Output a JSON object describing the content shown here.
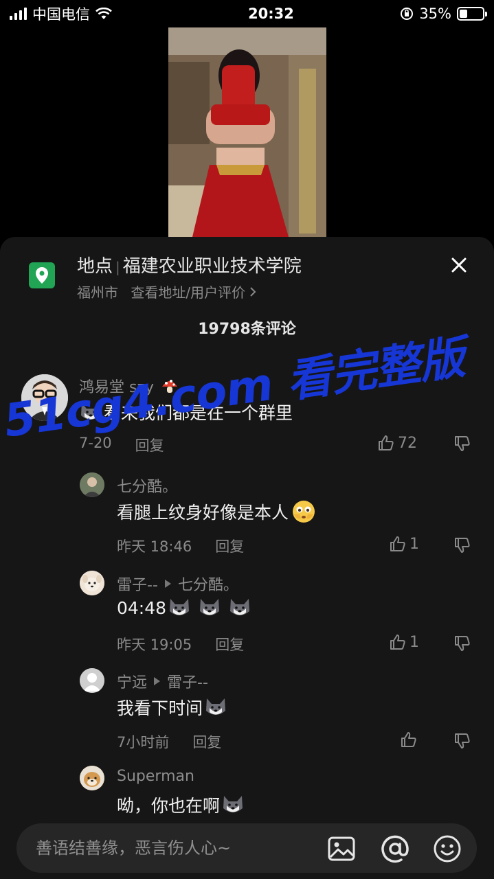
{
  "status_bar": {
    "carrier": "中国电信",
    "time": "20:32",
    "battery": "35%",
    "battery_level": 0.35
  },
  "location": {
    "label": "地点",
    "name": "福建农业职业技术学院",
    "city": "福州市",
    "link": "查看地址/用户评价"
  },
  "comments_count": "19798条评论",
  "comments": [
    {
      "name": "鸿易堂 szy",
      "text": "看来我们都是在一个群里",
      "date": "7-20",
      "reply": "回复",
      "likes": "72"
    },
    {
      "name": "七分酷。",
      "text": "看腿上纹身好像是本人",
      "date": "昨天 18:46",
      "reply": "回复",
      "likes": "1"
    },
    {
      "name": "雷子--",
      "reply_to": "七分酷。",
      "text": "04:48",
      "date": "昨天 19:05",
      "reply": "回复",
      "likes": "1"
    },
    {
      "name": "宁远",
      "reply_to": "雷子--",
      "text": "我看下时间",
      "date": "7小时前",
      "reply": "回复",
      "likes": ""
    },
    {
      "name": "Superman",
      "text": "呦，你也在啊"
    }
  ],
  "watermark": "51cg4.com 看完整版",
  "input": {
    "placeholder": "善语结善缘，恶言伤人心~"
  },
  "icons": [
    "location-pin-icon",
    "close-icon",
    "thumb-up-icon",
    "thumb-down-icon",
    "image-icon",
    "at-icon",
    "emoji-icon",
    "husky-emoji-icon",
    "mushroom-icon",
    "flushed-emoji-icon"
  ],
  "colors": {
    "accent_green": "#21a454",
    "watermark": "#1636d6",
    "sheet_bg": "#161616"
  }
}
